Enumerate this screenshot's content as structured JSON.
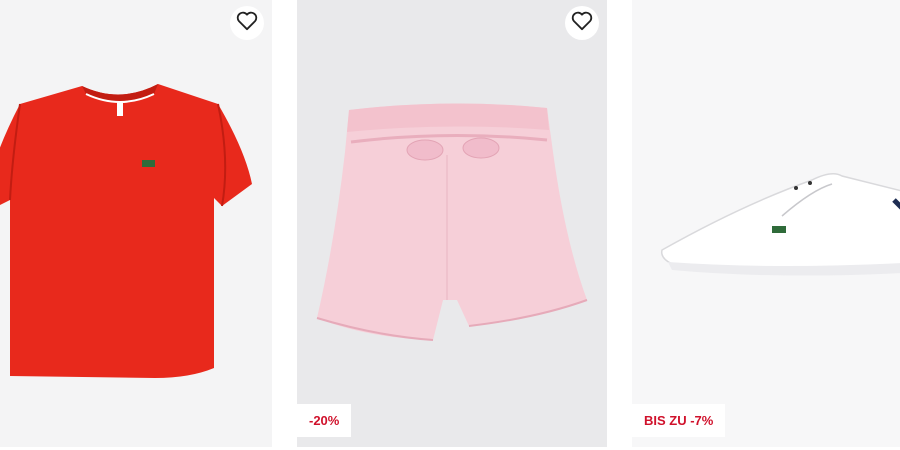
{
  "products": [
    {
      "id": "tshirt",
      "wishlist_icon": "heart-outline-icon",
      "badge": ""
    },
    {
      "id": "shorts",
      "wishlist_icon": "heart-outline-icon",
      "badge": "-20%"
    },
    {
      "id": "sneaker",
      "wishlist_icon": "",
      "badge": "BIS ZU -7%"
    }
  ],
  "colors": {
    "sale": "#d0112b",
    "tshirt": "#e8291c",
    "shorts": "#f6cfd8",
    "sneaker": "#ffffff"
  }
}
